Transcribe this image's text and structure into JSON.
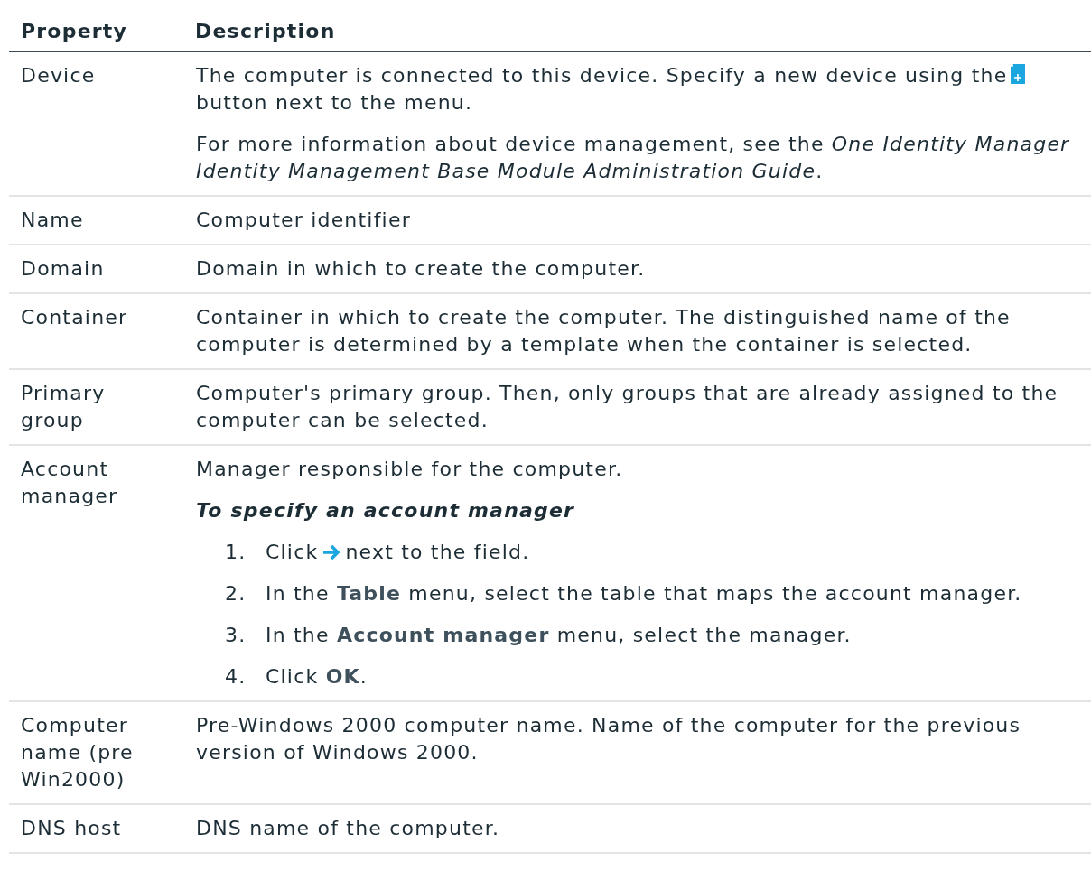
{
  "table": {
    "columns": [
      "Property",
      "Description"
    ],
    "rows": [
      {
        "property": "Device",
        "blocks": [
          {
            "kind": "text",
            "parts": [
              {
                "kind": "text",
                "text": "The computer is connected to this device. Specify a new device using the"
              },
              {
                "kind": "button_icon"
              },
              {
                "kind": "text",
                "text": "button next to the menu."
              }
            ]
          },
          {
            "kind": "text",
            "parts": [
              {
                "kind": "text",
                "text": "For more information about device management, see the *One Identity Manager Identity Management Base Module Administration Guide*."
              }
            ]
          }
        ]
      },
      {
        "property": "Name",
        "blocks": [
          {
            "kind": "text",
            "parts": [
              {
                "kind": "text",
                "text": "Computer identifier"
              }
            ]
          }
        ]
      },
      {
        "property": "Domain",
        "blocks": [
          {
            "kind": "text",
            "parts": [
              {
                "kind": "text",
                "text": "Domain in which to create the computer."
              }
            ]
          }
        ]
      },
      {
        "property": "Container",
        "blocks": [
          {
            "kind": "text",
            "parts": [
              {
                "kind": "text",
                "text": "Container in which to create the computer. The distinguished name of the computer is determined by a template when the container is selected."
              }
            ]
          }
        ]
      },
      {
        "property": "Primary group",
        "blocks": [
          {
            "kind": "text",
            "parts": [
              {
                "kind": "text",
                "text": "Computer's primary group. Then, only groups that are already assigned to the computer can be selected."
              }
            ]
          }
        ]
      },
      {
        "property": "Account manager",
        "blocks": [
          {
            "kind": "text",
            "parts": [
              {
                "kind": "text",
                "text": "Manager responsible for the computer."
              }
            ]
          },
          {
            "kind": "heading",
            "text": "To specify an account manager"
          },
          {
            "kind": "steps",
            "steps": [
              {
                "number": "1.",
                "parts": [
                  {
                    "kind": "text",
                    "text": "Click"
                  },
                  {
                    "kind": "link_icon"
                  },
                  {
                    "kind": "text",
                    "text": "next to the field."
                  }
                ]
              },
              {
                "number": "2.",
                "parts": [
                  {
                    "kind": "text",
                    "text": "In the **Table** menu, select the table that maps the account manager."
                  }
                ]
              },
              {
                "number": "3.",
                "parts": [
                  {
                    "kind": "text",
                    "text": "In the **Account manager** menu, select the manager."
                  }
                ]
              },
              {
                "number": "4.",
                "parts": [
                  {
                    "kind": "text",
                    "text": "Click **OK**."
                  }
                ]
              }
            ]
          }
        ]
      },
      {
        "property": "Computer name (pre Win2000)",
        "blocks": [
          {
            "kind": "text",
            "parts": [
              {
                "kind": "text",
                "text": "Pre-Windows 2000 computer name. Name of the computer for the previous version of Windows 2000."
              }
            ]
          }
        ]
      },
      {
        "property": "DNS host",
        "blocks": [
          {
            "kind": "text",
            "parts": [
              {
                "kind": "text",
                "text": "DNS name of the computer."
              }
            ]
          }
        ]
      }
    ]
  }
}
